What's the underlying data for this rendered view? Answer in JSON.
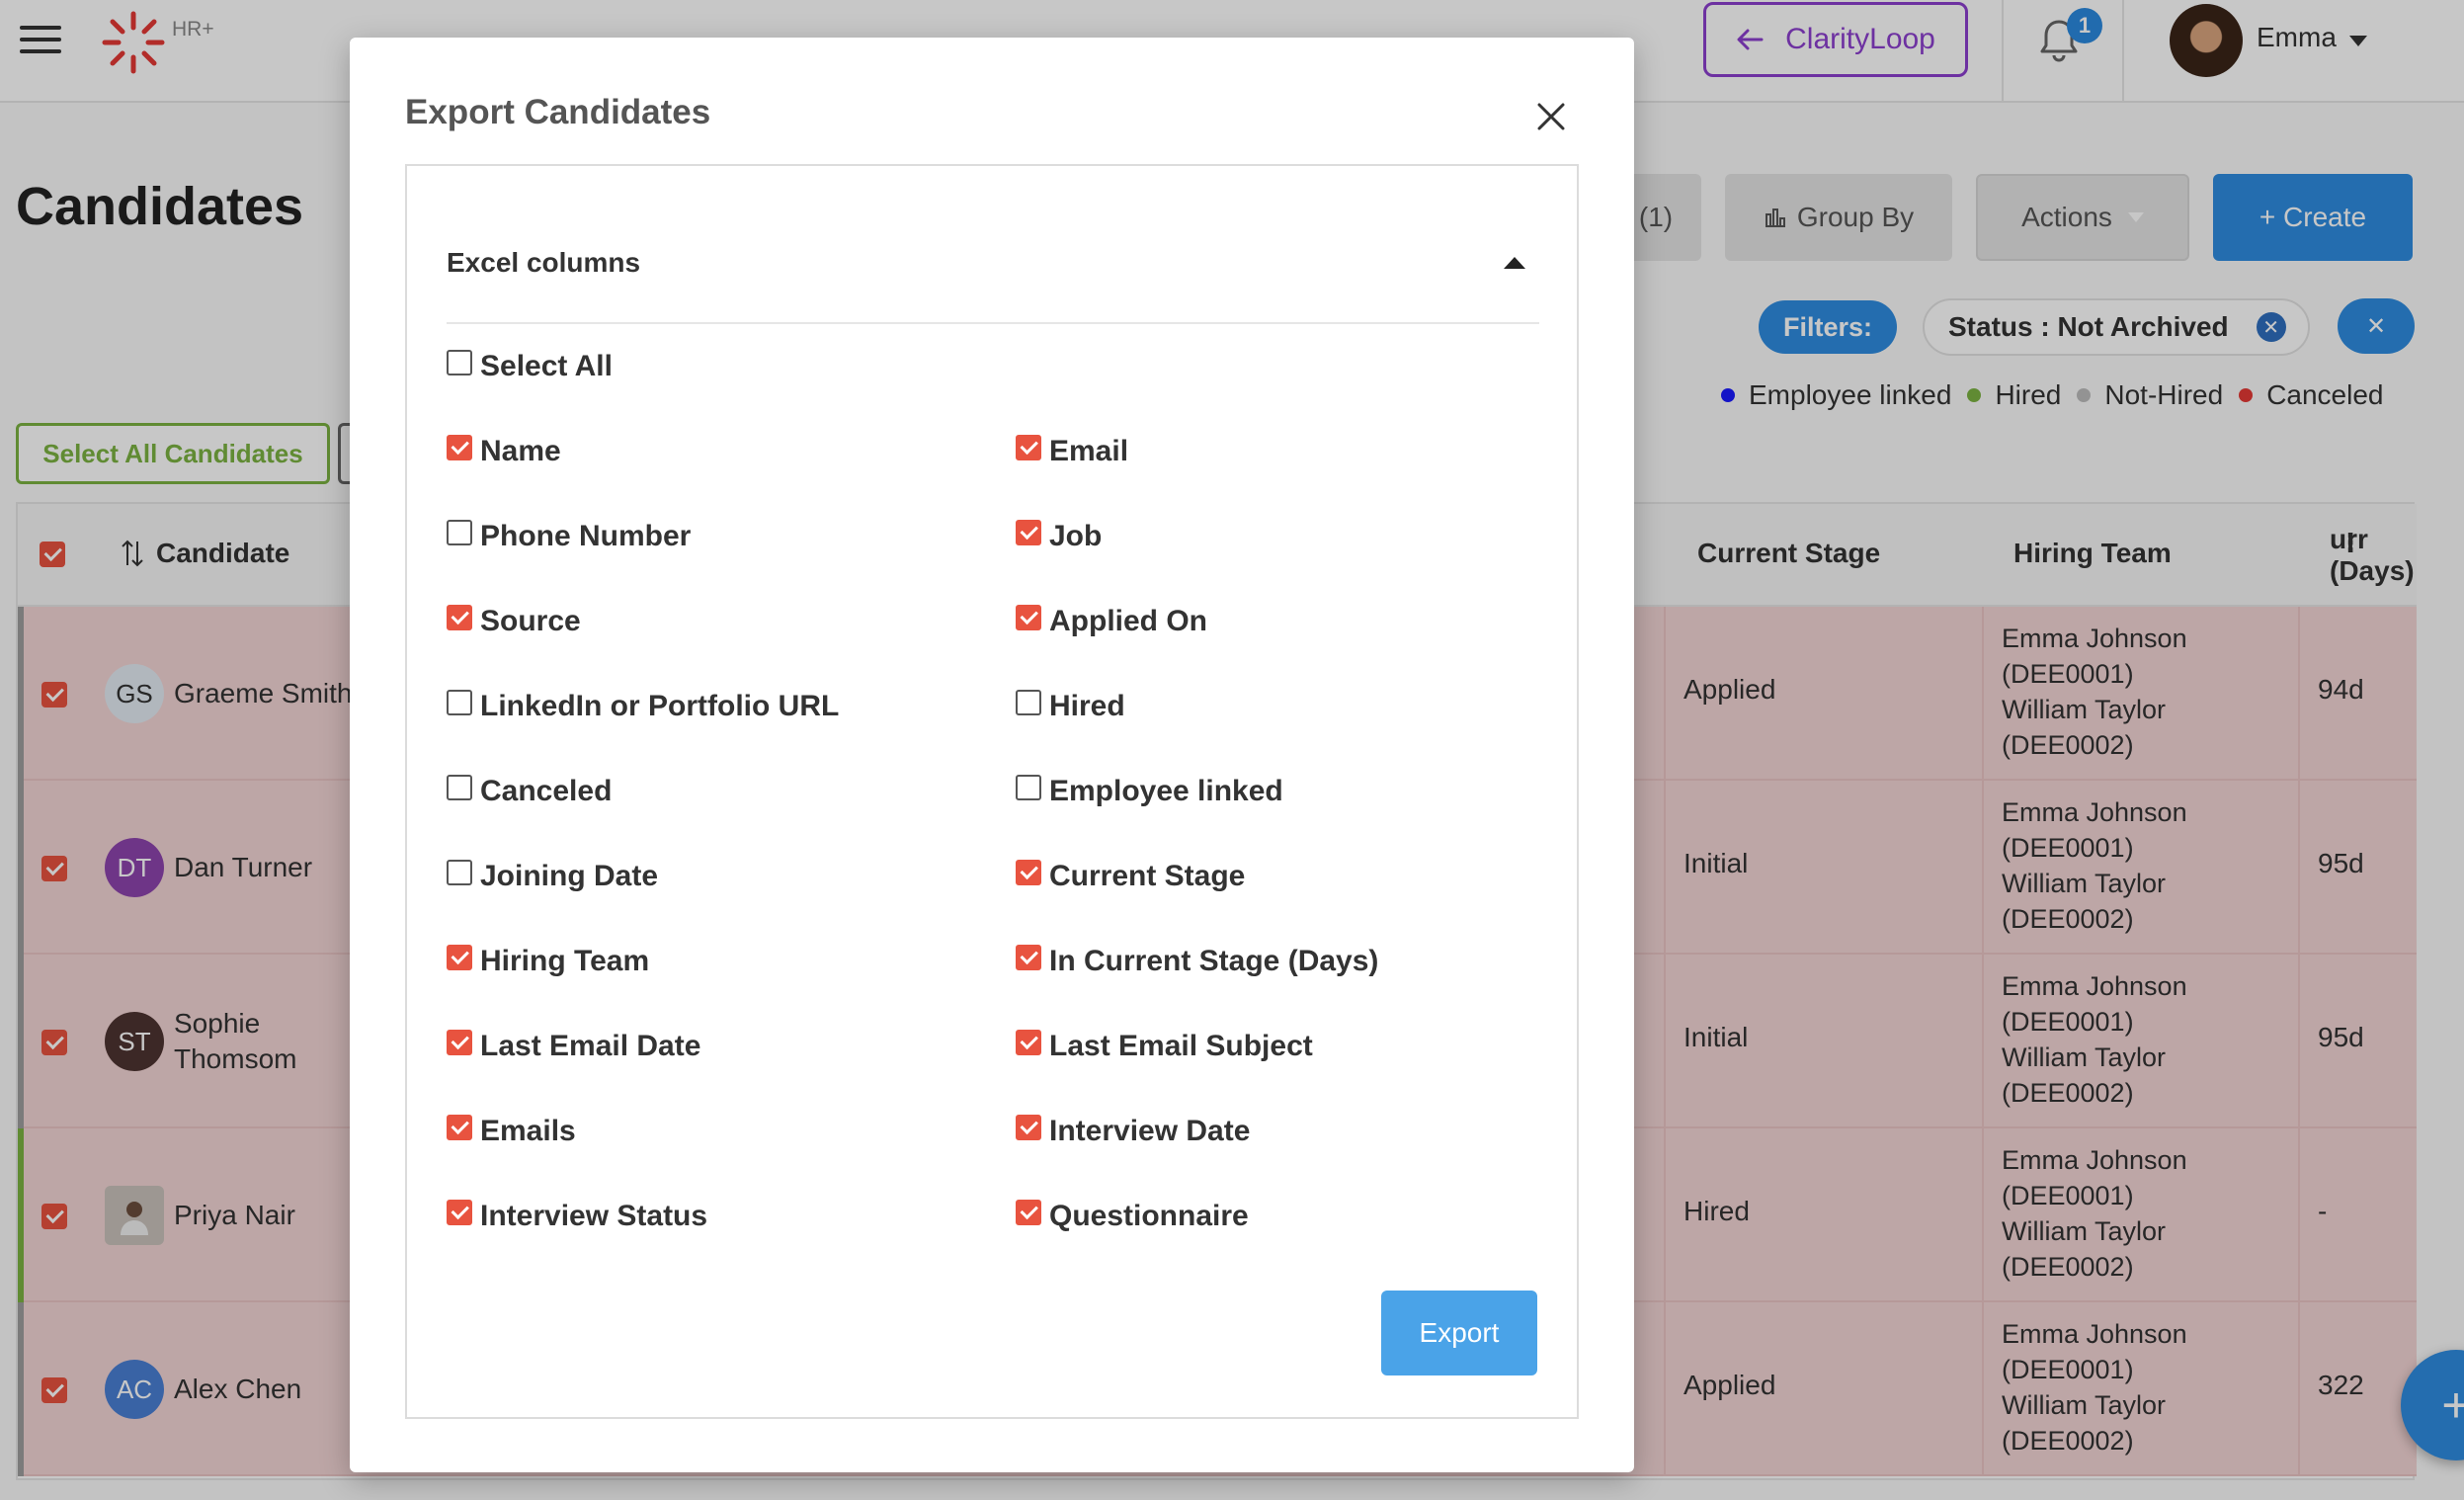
{
  "header": {
    "logo_text": "HR+",
    "clarity_label": "ClarityLoop",
    "notification_count": "1",
    "user_name": "Emma"
  },
  "page": {
    "title": "Candidates",
    "filter_count_label": "(1)",
    "group_by_label": "Group By",
    "actions_label": "Actions",
    "create_label": "+ Create",
    "select_all_candidates_label": "Select All Candidates"
  },
  "filters": {
    "label": "Filters:",
    "active": "Status : Not Archived"
  },
  "legend": [
    {
      "label": "Employee linked",
      "color": "#1a1aff"
    },
    {
      "label": "Hired",
      "color": "#7cb342"
    },
    {
      "label": "Not-Hired",
      "color": "#bdbdbd"
    },
    {
      "label": "Canceled",
      "color": "#e53935"
    }
  ],
  "table": {
    "headers": {
      "candidate": "Candidate",
      "current_stage": "Current Stage",
      "hiring_team": "Hiring Team",
      "in_stage": "urr\n(Days)"
    },
    "rows": [
      {
        "initials": "GS",
        "name": "Graeme Smith",
        "stage": "Applied",
        "team": "Emma Johnson\n(DEE0001)\nWilliam Taylor\n(DEE0002)",
        "days": "94d",
        "avatar_color": "#e3ebf3"
      },
      {
        "initials": "DT",
        "name": "Dan Turner",
        "stage": "Initial",
        "team": "Emma Johnson\n(DEE0001)\nWilliam Taylor\n(DEE0002)",
        "days": "95d",
        "avatar_color": "#8e44ad"
      },
      {
        "initials": "ST",
        "name": "Sophie\nThomsom",
        "stage": "Initial",
        "team": "Emma Johnson\n(DEE0001)\nWilliam Taylor\n(DEE0002)",
        "days": "95d",
        "avatar_color": "#4e3431"
      },
      {
        "initials": "",
        "name": "Priya Nair",
        "stage": "Hired",
        "team": "Emma Johnson\n(DEE0001)\nWilliam Taylor\n(DEE0002)",
        "days": "-",
        "avatar_color": "#c9c2bb"
      },
      {
        "initials": "AC",
        "name": "Alex Chen",
        "stage": "Applied",
        "team": "Emma Johnson\n(DEE0001)\nWilliam Taylor\n(DEE0002)",
        "days": "322",
        "avatar_color": "#4a7fd4"
      }
    ]
  },
  "modal": {
    "title": "Export Candidates",
    "section_title": "Excel columns",
    "select_all_label": "Select All",
    "select_all_checked": false,
    "options": [
      {
        "label": "Name",
        "checked": true
      },
      {
        "label": "Email",
        "checked": true
      },
      {
        "label": "Phone Number",
        "checked": false
      },
      {
        "label": "Job",
        "checked": true
      },
      {
        "label": "Source",
        "checked": true
      },
      {
        "label": "Applied On",
        "checked": true
      },
      {
        "label": "LinkedIn or Portfolio URL",
        "checked": false
      },
      {
        "label": "Hired",
        "checked": false
      },
      {
        "label": "Canceled",
        "checked": false
      },
      {
        "label": "Employee linked",
        "checked": false
      },
      {
        "label": "Joining Date",
        "checked": false
      },
      {
        "label": "Current Stage",
        "checked": true
      },
      {
        "label": "Hiring Team",
        "checked": true
      },
      {
        "label": "In Current Stage (Days)",
        "checked": true
      },
      {
        "label": "Last Email Date",
        "checked": true
      },
      {
        "label": "Last Email Subject",
        "checked": true
      },
      {
        "label": "Emails",
        "checked": true
      },
      {
        "label": "Interview Date",
        "checked": true
      },
      {
        "label": "Interview Status",
        "checked": true
      },
      {
        "label": "Questionnaire",
        "checked": true
      }
    ],
    "export_label": "Export"
  }
}
